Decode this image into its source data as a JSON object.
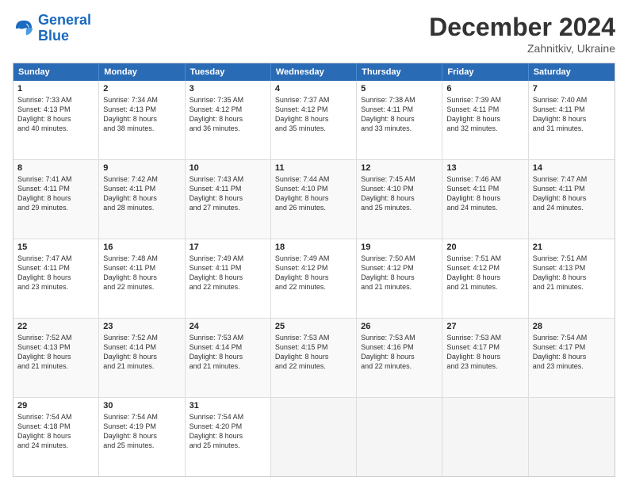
{
  "logo": {
    "line1": "General",
    "line2": "Blue"
  },
  "title": "December 2024",
  "subtitle": "Zahnitkiv, Ukraine",
  "days": [
    "Sunday",
    "Monday",
    "Tuesday",
    "Wednesday",
    "Thursday",
    "Friday",
    "Saturday"
  ],
  "weeks": [
    [
      {
        "day": "1",
        "sunrise": "7:33 AM",
        "sunset": "4:13 PM",
        "daylight": "8 hours and 40 minutes."
      },
      {
        "day": "2",
        "sunrise": "7:34 AM",
        "sunset": "4:13 PM",
        "daylight": "8 hours and 38 minutes."
      },
      {
        "day": "3",
        "sunrise": "7:35 AM",
        "sunset": "4:12 PM",
        "daylight": "8 hours and 36 minutes."
      },
      {
        "day": "4",
        "sunrise": "7:37 AM",
        "sunset": "4:12 PM",
        "daylight": "8 hours and 35 minutes."
      },
      {
        "day": "5",
        "sunrise": "7:38 AM",
        "sunset": "4:11 PM",
        "daylight": "8 hours and 33 minutes."
      },
      {
        "day": "6",
        "sunrise": "7:39 AM",
        "sunset": "4:11 PM",
        "daylight": "8 hours and 32 minutes."
      },
      {
        "day": "7",
        "sunrise": "7:40 AM",
        "sunset": "4:11 PM",
        "daylight": "8 hours and 31 minutes."
      }
    ],
    [
      {
        "day": "8",
        "sunrise": "7:41 AM",
        "sunset": "4:11 PM",
        "daylight": "8 hours and 29 minutes."
      },
      {
        "day": "9",
        "sunrise": "7:42 AM",
        "sunset": "4:11 PM",
        "daylight": "8 hours and 28 minutes."
      },
      {
        "day": "10",
        "sunrise": "7:43 AM",
        "sunset": "4:11 PM",
        "daylight": "8 hours and 27 minutes."
      },
      {
        "day": "11",
        "sunrise": "7:44 AM",
        "sunset": "4:10 PM",
        "daylight": "8 hours and 26 minutes."
      },
      {
        "day": "12",
        "sunrise": "7:45 AM",
        "sunset": "4:10 PM",
        "daylight": "8 hours and 25 minutes."
      },
      {
        "day": "13",
        "sunrise": "7:46 AM",
        "sunset": "4:11 PM",
        "daylight": "8 hours and 24 minutes."
      },
      {
        "day": "14",
        "sunrise": "7:47 AM",
        "sunset": "4:11 PM",
        "daylight": "8 hours and 24 minutes."
      }
    ],
    [
      {
        "day": "15",
        "sunrise": "7:47 AM",
        "sunset": "4:11 PM",
        "daylight": "8 hours and 23 minutes."
      },
      {
        "day": "16",
        "sunrise": "7:48 AM",
        "sunset": "4:11 PM",
        "daylight": "8 hours and 22 minutes."
      },
      {
        "day": "17",
        "sunrise": "7:49 AM",
        "sunset": "4:11 PM",
        "daylight": "8 hours and 22 minutes."
      },
      {
        "day": "18",
        "sunrise": "7:49 AM",
        "sunset": "4:12 PM",
        "daylight": "8 hours and 22 minutes."
      },
      {
        "day": "19",
        "sunrise": "7:50 AM",
        "sunset": "4:12 PM",
        "daylight": "8 hours and 21 minutes."
      },
      {
        "day": "20",
        "sunrise": "7:51 AM",
        "sunset": "4:12 PM",
        "daylight": "8 hours and 21 minutes."
      },
      {
        "day": "21",
        "sunrise": "7:51 AM",
        "sunset": "4:13 PM",
        "daylight": "8 hours and 21 minutes."
      }
    ],
    [
      {
        "day": "22",
        "sunrise": "7:52 AM",
        "sunset": "4:13 PM",
        "daylight": "8 hours and 21 minutes."
      },
      {
        "day": "23",
        "sunrise": "7:52 AM",
        "sunset": "4:14 PM",
        "daylight": "8 hours and 21 minutes."
      },
      {
        "day": "24",
        "sunrise": "7:53 AM",
        "sunset": "4:14 PM",
        "daylight": "8 hours and 21 minutes."
      },
      {
        "day": "25",
        "sunrise": "7:53 AM",
        "sunset": "4:15 PM",
        "daylight": "8 hours and 22 minutes."
      },
      {
        "day": "26",
        "sunrise": "7:53 AM",
        "sunset": "4:16 PM",
        "daylight": "8 hours and 22 minutes."
      },
      {
        "day": "27",
        "sunrise": "7:53 AM",
        "sunset": "4:17 PM",
        "daylight": "8 hours and 23 minutes."
      },
      {
        "day": "28",
        "sunrise": "7:54 AM",
        "sunset": "4:17 PM",
        "daylight": "8 hours and 23 minutes."
      }
    ],
    [
      {
        "day": "29",
        "sunrise": "7:54 AM",
        "sunset": "4:18 PM",
        "daylight": "8 hours and 24 minutes."
      },
      {
        "day": "30",
        "sunrise": "7:54 AM",
        "sunset": "4:19 PM",
        "daylight": "8 hours and 25 minutes."
      },
      {
        "day": "31",
        "sunrise": "7:54 AM",
        "sunset": "4:20 PM",
        "daylight": "8 hours and 25 minutes."
      },
      null,
      null,
      null,
      null
    ]
  ]
}
